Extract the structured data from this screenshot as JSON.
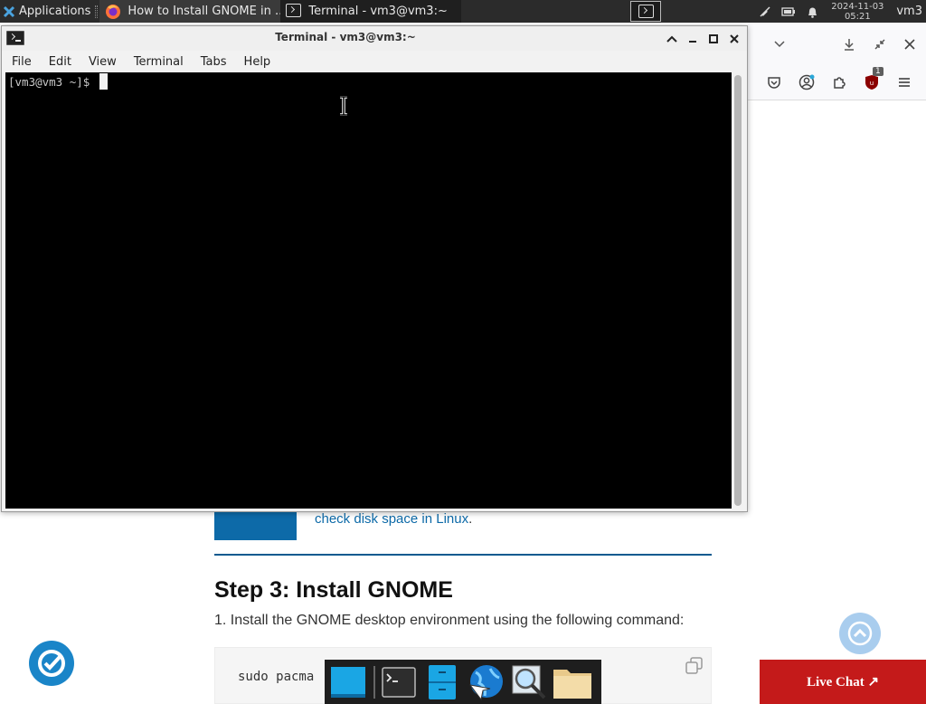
{
  "top_panel": {
    "applications_label": "Applications",
    "tasks": [
      {
        "label": "How to Install GNOME in ...",
        "icon": "firefox-icon"
      },
      {
        "label": "Terminal - vm3@vm3:~",
        "icon": "terminal-icon"
      }
    ],
    "clock_date": "2024-11-03",
    "clock_time": "05:21",
    "user": "vm3"
  },
  "terminal": {
    "title": "Terminal - vm3@vm3:~",
    "menu": [
      "File",
      "Edit",
      "View",
      "Terminal",
      "Tabs",
      "Help"
    ],
    "prompt": "[vm3@vm3 ~]$ "
  },
  "browser": {
    "toolbar_badge": "1"
  },
  "article": {
    "link_text": "check disk space in Linux",
    "link_suffix": ".",
    "heading": "Step 3: Install GNOME",
    "paragraph": "1. Install the GNOME desktop environment using the following command:",
    "code": "sudo pacma"
  },
  "live_chat": {
    "label": "Live Chat ↗"
  },
  "colors": {
    "accent_blue": "#0d6aa8",
    "live_chat_red": "#c41a1a",
    "terminal_bg": "#000000"
  }
}
